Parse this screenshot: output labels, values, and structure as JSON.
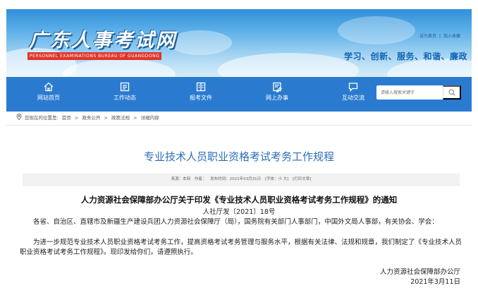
{
  "header": {
    "logo_title": "广东人事考试网",
    "logo_subtitle": "PERSONNEL EXAMINATIONS BUREAU OF GUANGDONG",
    "top_links": [
      "设为首页",
      "加入收藏"
    ],
    "top_links_separator": "|",
    "slogan": "学习、创新、服务、和谐、廉政"
  },
  "nav": {
    "items": [
      {
        "label": "网站首页",
        "icon": "home-icon"
      },
      {
        "label": "工作动态",
        "icon": "news-icon"
      },
      {
        "label": "报考文件",
        "icon": "document-icon"
      },
      {
        "label": "网上办事",
        "icon": "online-service-icon"
      },
      {
        "label": "互动交流",
        "icon": "chat-icon"
      }
    ],
    "search": {
      "placeholder": "请输入搜索关键字",
      "icon": "search-icon"
    }
  },
  "breadcrumb": {
    "prefix": "您现在的位置是:",
    "items": [
      "首页",
      "政务公开",
      "政策法规",
      "详细内容"
    ],
    "separator": ">"
  },
  "article": {
    "title": "专业技术人员职业资格考试考务工作规程",
    "meta": {
      "source": "来源：本网",
      "author": "作者：",
      "date": "发布时间：2021年03月31日",
      "font": "[字体：小 大]",
      "print": "[打印文章]"
    },
    "notice_title": "人力资源社会保障部办公厅关于印发《专业技术人员职业资格考试考务工作规程》的通知",
    "doc_number": "人社厅发〔2021〕18号",
    "paragraphs": [
      "各省、自治区、直辖市及新疆生产建设兵团人力资源社会保障厅（局），国务院有关部门人事部门，中国外文局人事部，有关协会、学会：",
      "为进一步规范专业技术人员职业资格考试考务工作，提高资格考试考务管理与服务水平，根据有关法律、法规和规章，我们制定了《专业技术人员职业资格考试考务工作规程》。现印发给你们，请遵照执行。"
    ],
    "signature": "人力资源社会保障部办公厅",
    "sign_date": "2021年3月11日"
  },
  "colors": {
    "nav_bg": "#2a7bd0",
    "title_blue": "#2b6fb8",
    "logo_red": "#e0352b"
  }
}
